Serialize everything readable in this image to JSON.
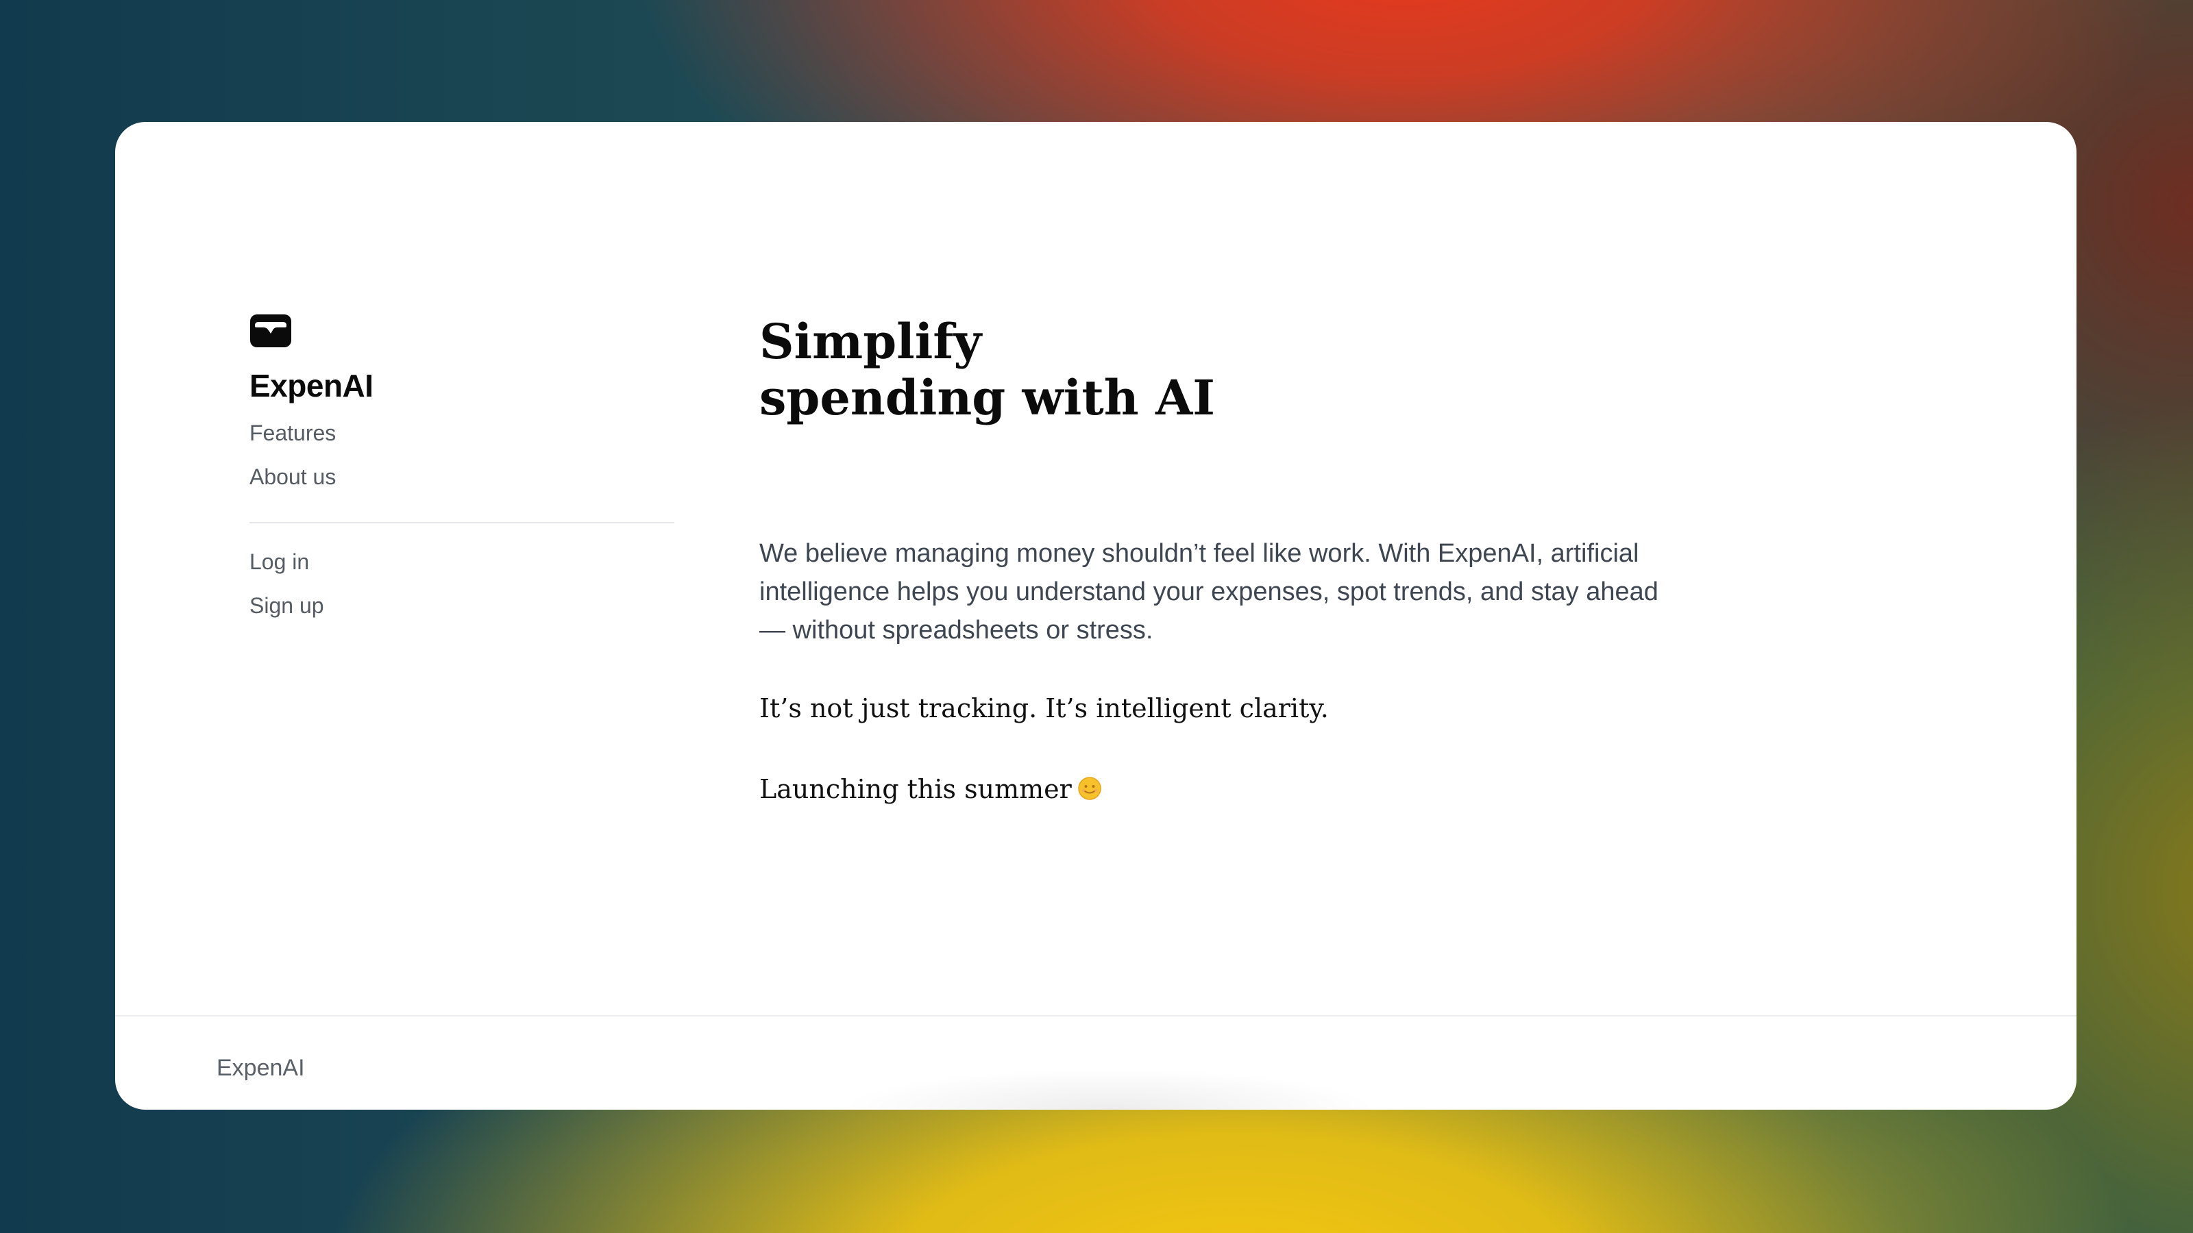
{
  "brand": {
    "name": "ExpenAI",
    "logo_icon": "wallet-icon"
  },
  "nav": {
    "primary": [
      {
        "label": "Features"
      },
      {
        "label": "About us"
      }
    ],
    "account": [
      {
        "label": "Log in"
      },
      {
        "label": "Sign up"
      }
    ]
  },
  "hero": {
    "headline_line1": "Simplify",
    "headline_line2": "spending with AI",
    "intro": "We believe managing money shouldn’t feel like work. With ExpenAI, artificial intelligence helps you understand your expenses, spot trends, and stay ahead — without spreadsheets or stress.",
    "tagline": "It’s not just tracking. It’s intelligent clarity.",
    "launch": "Launching this summer",
    "launch_icon": "sun-face-emoji"
  },
  "footer": {
    "brand": "ExpenAI"
  },
  "colors": {
    "card_background": "#ffffff",
    "text_primary": "#0b0b0b",
    "text_muted": "#555b63",
    "accent_sun": "#f5b81c"
  }
}
